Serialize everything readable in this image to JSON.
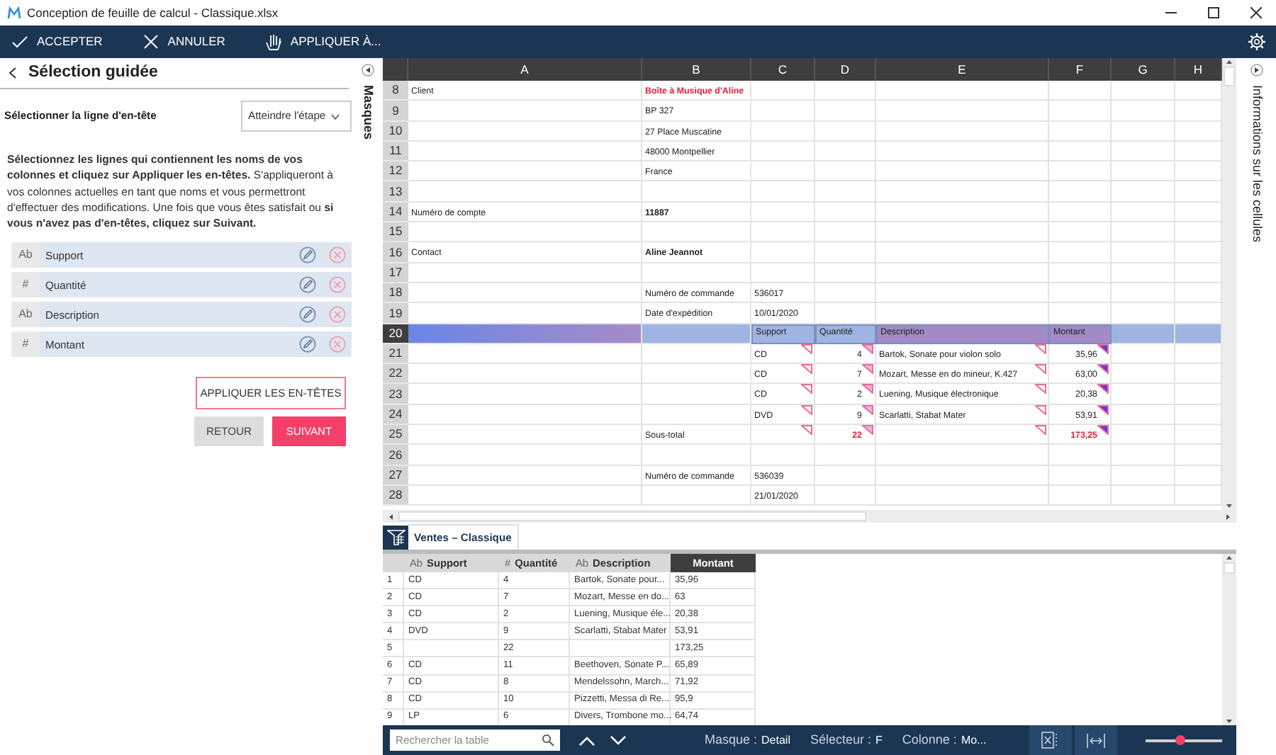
{
  "window": {
    "title": "Conception de feuille de calcul - Classique.xlsx"
  },
  "toolbar": [
    {
      "kind": "accept",
      "label": "ACCEPTER"
    },
    {
      "kind": "cancel",
      "label": "ANNULER"
    },
    {
      "kind": "apply",
      "label": "APPLIQUER À..."
    }
  ],
  "guide": {
    "title": "Sélection guidée",
    "step_label": "Sélectionner la ligne d'en-tête",
    "step_dropdown": "Atteindre l'étape",
    "instructions": "**Sélectionnez les lignes qui contiennent les noms de vos colonnes et cliquez sur Appliquer les en-têtes.** S'appliqueront à vos colonnes actuelles en tant que noms et vous permettront d'effectuer des modifications. Une fois que vous êtes satisfait ou **si vous n'avez pas d'en-têtes, cliquez sur Suivant.**",
    "columns": [
      {
        "type_label": "Ab",
        "name": "Support"
      },
      {
        "type_label": "#",
        "name": "Quantité"
      },
      {
        "type_label": "Ab",
        "name": "Description"
      },
      {
        "type_label": "#",
        "name": "Montant"
      }
    ],
    "apply_button": "APPLIQUER LES EN-TÊTES",
    "back_button": "RETOUR",
    "next_button": "SUIVANT"
  },
  "left_strip": {
    "label": "Masques"
  },
  "sheet": {
    "columns": [
      "A",
      "B",
      "C",
      "D",
      "E",
      "F",
      "G",
      "H"
    ],
    "rows": [
      {
        "number": "8",
        "selected": false,
        "cells": {
          "a": {
            "text": "Client"
          },
          "b": {
            "text": "Boîte à Musique d'Aline",
            "kind": "title"
          }
        }
      },
      {
        "number": "9",
        "selected": false,
        "cells": {
          "b": {
            "text": "BP 327"
          }
        }
      },
      {
        "number": "10",
        "selected": false,
        "cells": {
          "b": {
            "text": "27 Place Muscatine"
          }
        }
      },
      {
        "number": "11",
        "selected": false,
        "cells": {
          "b": {
            "text": "48000 Montpellier"
          }
        }
      },
      {
        "number": "12",
        "selected": false,
        "cells": {
          "b": {
            "text": "France"
          }
        }
      },
      {
        "number": "13",
        "selected": false,
        "cells": {}
      },
      {
        "number": "14",
        "selected": false,
        "cells": {
          "a": {
            "text": "Numéro de compte"
          },
          "b": {
            "text": "11887",
            "kind": "bold"
          }
        }
      },
      {
        "number": "15",
        "selected": false,
        "cells": {}
      },
      {
        "number": "16",
        "selected": false,
        "cells": {
          "a": {
            "text": "Contact"
          },
          "b": {
            "text": "Aline Jeannot",
            "kind": "bold"
          }
        }
      },
      {
        "number": "17",
        "selected": false,
        "cells": {}
      },
      {
        "number": "18",
        "selected": false,
        "cells": {
          "b": {
            "text": "Numéro de commande"
          },
          "c": {
            "text": "536017"
          }
        }
      },
      {
        "number": "19",
        "selected": false,
        "cells": {
          "b": {
            "text": "Date d'expédition"
          },
          "c": {
            "text": "10/01/2020"
          }
        }
      },
      {
        "number": "20",
        "selected": true,
        "cells": {
          "c": {
            "text": "Support",
            "color": "#9fb4e0"
          },
          "d": {
            "text": "Quantité",
            "color": "#9fb4e0"
          },
          "e": {
            "text": "Description",
            "color": "#a28bc6"
          },
          "f": {
            "text": "Montant",
            "color": "#a28bc6"
          }
        }
      },
      {
        "number": "21",
        "selected": false,
        "cells": {
          "c": {
            "text": "CD",
            "flag": {
              "kind": "outline"
            }
          },
          "d": {
            "text": "4",
            "kind": "number",
            "flag": {
              "kind": "tinted"
            }
          },
          "e": {
            "text": "Bartok, Sonate pour violon solo",
            "flag": {
              "kind": "outline"
            }
          },
          "f": {
            "text": "35,96",
            "kind": "number",
            "flag": {
              "kind": "solid"
            }
          }
        }
      },
      {
        "number": "22",
        "selected": false,
        "cells": {
          "c": {
            "text": "CD",
            "flag": {
              "kind": "outline"
            }
          },
          "d": {
            "text": "7",
            "kind": "number",
            "flag": {
              "kind": "tinted"
            }
          },
          "e": {
            "text": "Mozart, Messe en do mineur, K.427",
            "flag": {
              "kind": "outline"
            }
          },
          "f": {
            "text": "63,00",
            "kind": "number",
            "flag": {
              "kind": "solid"
            }
          }
        }
      },
      {
        "number": "23",
        "selected": false,
        "cells": {
          "c": {
            "text": "CD",
            "flag": {
              "kind": "outline"
            }
          },
          "d": {
            "text": "2",
            "kind": "number",
            "flag": {
              "kind": "tinted"
            }
          },
          "e": {
            "text": "Luening, Musique électronique",
            "flag": {
              "kind": "outline"
            }
          },
          "f": {
            "text": "20,38",
            "kind": "number",
            "flag": {
              "kind": "solid"
            }
          }
        }
      },
      {
        "number": "24",
        "selected": false,
        "cells": {
          "c": {
            "text": "DVD",
            "flag": {
              "kind": "outline"
            }
          },
          "d": {
            "text": "9",
            "kind": "number",
            "flag": {
              "kind": "tinted"
            }
          },
          "e": {
            "text": "Scarlatti, Stabat Mater",
            "flag": {
              "kind": "outline"
            }
          },
          "f": {
            "text": "53,91",
            "kind": "number",
            "flag": {
              "kind": "solid"
            }
          }
        }
      },
      {
        "number": "25",
        "selected": false,
        "cells": {
          "b": {
            "text": "Sous-total"
          },
          "c": {
            "flag": {
              "kind": "outline"
            }
          },
          "d": {
            "text": "22",
            "kind": "total",
            "flag": {
              "kind": "tinted"
            }
          },
          "e": {
            "flag": {
              "kind": "outline"
            }
          },
          "f": {
            "text": "173,25",
            "kind": "total",
            "flag": {
              "kind": "solid"
            }
          }
        }
      },
      {
        "number": "26",
        "selected": false,
        "cells": {}
      },
      {
        "number": "27",
        "selected": false,
        "cells": {
          "b": {
            "text": "Numéro de commande"
          },
          "c": {
            "text": "536039"
          }
        }
      },
      {
        "number": "28",
        "selected": false,
        "cells": {
          "c": {
            "text": "21/01/2020"
          }
        }
      }
    ]
  },
  "right_strip": {
    "label": "Informations sur les cellules"
  },
  "table_tabs": [
    {
      "label": "Ventes – Classique",
      "selected": true
    }
  ],
  "table": {
    "columns": [
      {
        "type_label": "Ab",
        "name": "Support",
        "selected": false
      },
      {
        "type_label": "#",
        "name": "Quantité",
        "selected": false
      },
      {
        "type_label": "Ab",
        "name": "Description",
        "selected": false
      },
      {
        "name": "Montant",
        "selected": true
      }
    ],
    "rows": [
      {
        "number": "1",
        "cells": [
          "CD",
          "4",
          "Bartok, Sonate pour...",
          "35,96"
        ]
      },
      {
        "number": "2",
        "cells": [
          "CD",
          "7",
          "Mozart, Messe en do...",
          "63"
        ]
      },
      {
        "number": "3",
        "cells": [
          "CD",
          "2",
          "Luening, Musique éle...",
          "20,38"
        ]
      },
      {
        "number": "4",
        "cells": [
          "DVD",
          "9",
          "Scarlatti, Stabat Mater",
          "53,91"
        ]
      },
      {
        "number": "5",
        "cells": [
          null,
          "22",
          null,
          "173,25"
        ]
      },
      {
        "number": "6",
        "cells": [
          "CD",
          "11",
          "Beethoven, Sonate P...",
          "65,89"
        ]
      },
      {
        "number": "7",
        "cells": [
          "CD",
          "8",
          "Mendelssohn, March...",
          "71,92"
        ]
      },
      {
        "number": "8",
        "cells": [
          "CD",
          "10",
          "Pizzetti, Messa di Re...",
          "95,9"
        ]
      },
      {
        "number": "9",
        "cells": [
          "LP",
          "6",
          "Divers, Trombone mo...",
          "64,74"
        ]
      }
    ]
  },
  "status_bar": {
    "search_placeholder": "Rechercher la table",
    "fields": [
      {
        "label": "Masque :",
        "value": "Detail"
      },
      {
        "label": "Sélecteur :",
        "value": "F"
      },
      {
        "label": "Colonne :",
        "value": "Mo..."
      }
    ],
    "zoom": {
      "level": 0.45
    }
  }
}
